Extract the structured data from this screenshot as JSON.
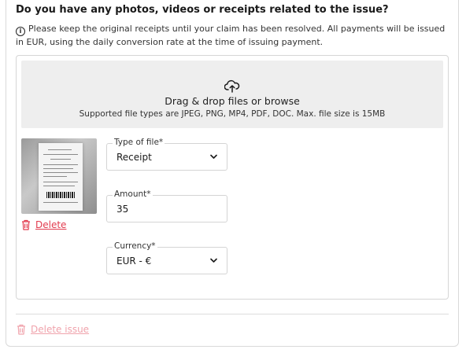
{
  "section": {
    "heading": "Do you have any photos, videos or receipts related to the issue?",
    "note": "Please keep the original receipts until your claim has been resolved. All payments will be issued in EUR, using the daily conversion rate at the time of issuing payment."
  },
  "dropzone": {
    "title": "Drag & drop files or browse",
    "subtitle": "Supported file types are JPEG, PNG, MP4, PDF, DOC. Max. file size is 15MB",
    "icon": "upload-cloud-icon"
  },
  "attachment": {
    "thumbnail": "receipt-image",
    "delete_label": "Delete"
  },
  "fields": {
    "type_of_file": {
      "label": "Type of file*",
      "value": "Receipt"
    },
    "amount": {
      "label": "Amount*",
      "value": "35"
    },
    "currency": {
      "label": "Currency*",
      "value": "EUR - €"
    }
  },
  "footer": {
    "delete_issue_label": "Delete issue"
  },
  "colors": {
    "accent_red": "#e23b4e",
    "disabled_red": "#f0a3ac",
    "dropzone_bg": "#eeeeee"
  }
}
